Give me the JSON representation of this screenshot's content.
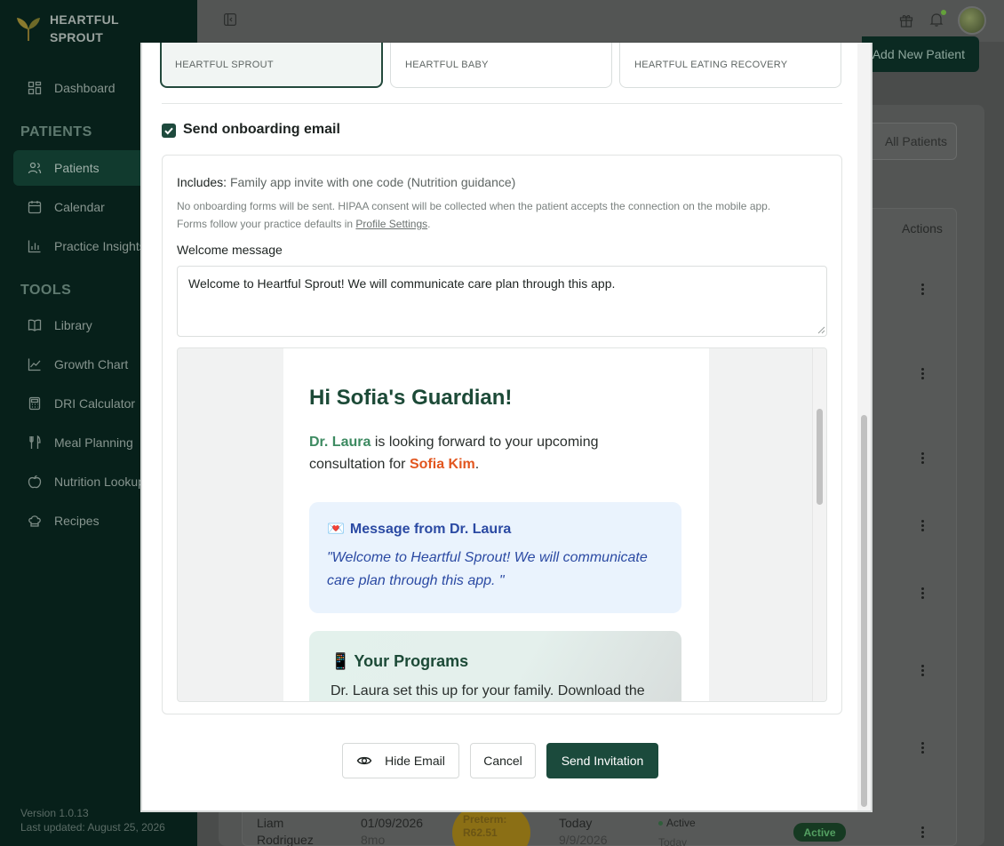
{
  "sidebar": {
    "brand": "HEARTFUL SPROUT",
    "dashboard": "Dashboard",
    "patients_section": "PATIENTS",
    "patients": "Patients",
    "calendar": "Calendar",
    "insights": "Practice Insights",
    "tools_section": "TOOLS",
    "library": "Library",
    "growth": "Growth Chart",
    "dri": "DRI Calculator",
    "meal": "Meal Planning",
    "nutrition": "Nutrition Lookup",
    "recipes": "Recipes",
    "version": "Version 1.0.13",
    "updated": "Last updated: August 25, 2026"
  },
  "header": {
    "add_patient": "Add New Patient",
    "all_patients": "All Patients",
    "actions": "Actions"
  },
  "row": {
    "name": "Liam Rodriguez",
    "dob": "01/09/2026",
    "age": "8mo",
    "badge": "Preterm: R62.51",
    "appt": "Today",
    "appt_date": "9/9/2026",
    "status": "Active",
    "status_sub": "Today",
    "pill": "Active"
  },
  "modal": {
    "programs": [
      "HEARTFUL SPROUT",
      "HEARTFUL BABY",
      "HEARTFUL EATING RECOVERY"
    ],
    "send_email_label": "Send onboarding email",
    "includes_label": "Includes:",
    "includes_value": "Family app invite with one code (Nutrition guidance)",
    "note1": "No onboarding forms will be sent. HIPAA consent will be collected when the patient accepts the connection on the mobile app.",
    "note2_prefix": "Forms follow your practice defaults in",
    "note2_link": "Profile Settings",
    "note2_suffix": ".",
    "welcome_label": "Welcome message",
    "welcome_value": "Welcome to Heartful Sprout! We will communicate care plan through this app.",
    "preview": {
      "greeting": "Hi Sofia's Guardian!",
      "dr_name": "Dr. Laura",
      "intro_mid": "is looking forward to your upcoming consultation for",
      "kid_name": "Sofia Kim",
      "intro_end": ".",
      "msg_emoji": "💌",
      "msg_title": "Message from Dr. Laura",
      "msg_body": "\"Welcome to Heartful Sprout! We will communicate care plan through this app. \"",
      "prog_emoji": "📱",
      "prog_title": "Your Programs",
      "prog_body": "Dr. Laura set this up for your family. Download the"
    },
    "hide_email": "Hide Email",
    "cancel": "Cancel",
    "send": "Send Invitation"
  },
  "colors": {
    "brand_dark": "#1b4a3c",
    "sidebar_bg": "#07201a",
    "accent_green": "#3d8a61",
    "accent_orange": "#e2561f",
    "message_blue": "#2b4aa3"
  }
}
